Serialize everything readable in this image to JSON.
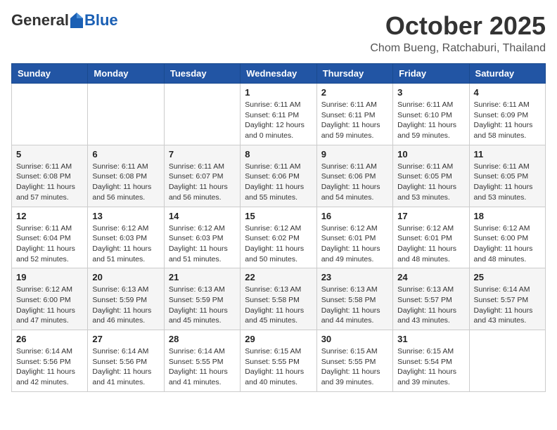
{
  "header": {
    "logo_general": "General",
    "logo_blue": "Blue",
    "month": "October 2025",
    "location": "Chom Bueng, Ratchaburi, Thailand"
  },
  "weekdays": [
    "Sunday",
    "Monday",
    "Tuesday",
    "Wednesday",
    "Thursday",
    "Friday",
    "Saturday"
  ],
  "weeks": [
    [
      null,
      null,
      null,
      {
        "day": "1",
        "sunrise": "6:11 AM",
        "sunset": "6:11 PM",
        "daylight": "12 hours and 0 minutes."
      },
      {
        "day": "2",
        "sunrise": "6:11 AM",
        "sunset": "6:11 PM",
        "daylight": "11 hours and 59 minutes."
      },
      {
        "day": "3",
        "sunrise": "6:11 AM",
        "sunset": "6:10 PM",
        "daylight": "11 hours and 59 minutes."
      },
      {
        "day": "4",
        "sunrise": "6:11 AM",
        "sunset": "6:09 PM",
        "daylight": "11 hours and 58 minutes."
      }
    ],
    [
      {
        "day": "5",
        "sunrise": "6:11 AM",
        "sunset": "6:08 PM",
        "daylight": "11 hours and 57 minutes."
      },
      {
        "day": "6",
        "sunrise": "6:11 AM",
        "sunset": "6:08 PM",
        "daylight": "11 hours and 56 minutes."
      },
      {
        "day": "7",
        "sunrise": "6:11 AM",
        "sunset": "6:07 PM",
        "daylight": "11 hours and 56 minutes."
      },
      {
        "day": "8",
        "sunrise": "6:11 AM",
        "sunset": "6:06 PM",
        "daylight": "11 hours and 55 minutes."
      },
      {
        "day": "9",
        "sunrise": "6:11 AM",
        "sunset": "6:06 PM",
        "daylight": "11 hours and 54 minutes."
      },
      {
        "day": "10",
        "sunrise": "6:11 AM",
        "sunset": "6:05 PM",
        "daylight": "11 hours and 53 minutes."
      },
      {
        "day": "11",
        "sunrise": "6:11 AM",
        "sunset": "6:05 PM",
        "daylight": "11 hours and 53 minutes."
      }
    ],
    [
      {
        "day": "12",
        "sunrise": "6:11 AM",
        "sunset": "6:04 PM",
        "daylight": "11 hours and 52 minutes."
      },
      {
        "day": "13",
        "sunrise": "6:12 AM",
        "sunset": "6:03 PM",
        "daylight": "11 hours and 51 minutes."
      },
      {
        "day": "14",
        "sunrise": "6:12 AM",
        "sunset": "6:03 PM",
        "daylight": "11 hours and 51 minutes."
      },
      {
        "day": "15",
        "sunrise": "6:12 AM",
        "sunset": "6:02 PM",
        "daylight": "11 hours and 50 minutes."
      },
      {
        "day": "16",
        "sunrise": "6:12 AM",
        "sunset": "6:01 PM",
        "daylight": "11 hours and 49 minutes."
      },
      {
        "day": "17",
        "sunrise": "6:12 AM",
        "sunset": "6:01 PM",
        "daylight": "11 hours and 48 minutes."
      },
      {
        "day": "18",
        "sunrise": "6:12 AM",
        "sunset": "6:00 PM",
        "daylight": "11 hours and 48 minutes."
      }
    ],
    [
      {
        "day": "19",
        "sunrise": "6:12 AM",
        "sunset": "6:00 PM",
        "daylight": "11 hours and 47 minutes."
      },
      {
        "day": "20",
        "sunrise": "6:13 AM",
        "sunset": "5:59 PM",
        "daylight": "11 hours and 46 minutes."
      },
      {
        "day": "21",
        "sunrise": "6:13 AM",
        "sunset": "5:59 PM",
        "daylight": "11 hours and 45 minutes."
      },
      {
        "day": "22",
        "sunrise": "6:13 AM",
        "sunset": "5:58 PM",
        "daylight": "11 hours and 45 minutes."
      },
      {
        "day": "23",
        "sunrise": "6:13 AM",
        "sunset": "5:58 PM",
        "daylight": "11 hours and 44 minutes."
      },
      {
        "day": "24",
        "sunrise": "6:13 AM",
        "sunset": "5:57 PM",
        "daylight": "11 hours and 43 minutes."
      },
      {
        "day": "25",
        "sunrise": "6:14 AM",
        "sunset": "5:57 PM",
        "daylight": "11 hours and 43 minutes."
      }
    ],
    [
      {
        "day": "26",
        "sunrise": "6:14 AM",
        "sunset": "5:56 PM",
        "daylight": "11 hours and 42 minutes."
      },
      {
        "day": "27",
        "sunrise": "6:14 AM",
        "sunset": "5:56 PM",
        "daylight": "11 hours and 41 minutes."
      },
      {
        "day": "28",
        "sunrise": "6:14 AM",
        "sunset": "5:55 PM",
        "daylight": "11 hours and 41 minutes."
      },
      {
        "day": "29",
        "sunrise": "6:15 AM",
        "sunset": "5:55 PM",
        "daylight": "11 hours and 40 minutes."
      },
      {
        "day": "30",
        "sunrise": "6:15 AM",
        "sunset": "5:55 PM",
        "daylight": "11 hours and 39 minutes."
      },
      {
        "day": "31",
        "sunrise": "6:15 AM",
        "sunset": "5:54 PM",
        "daylight": "11 hours and 39 minutes."
      },
      null
    ]
  ]
}
